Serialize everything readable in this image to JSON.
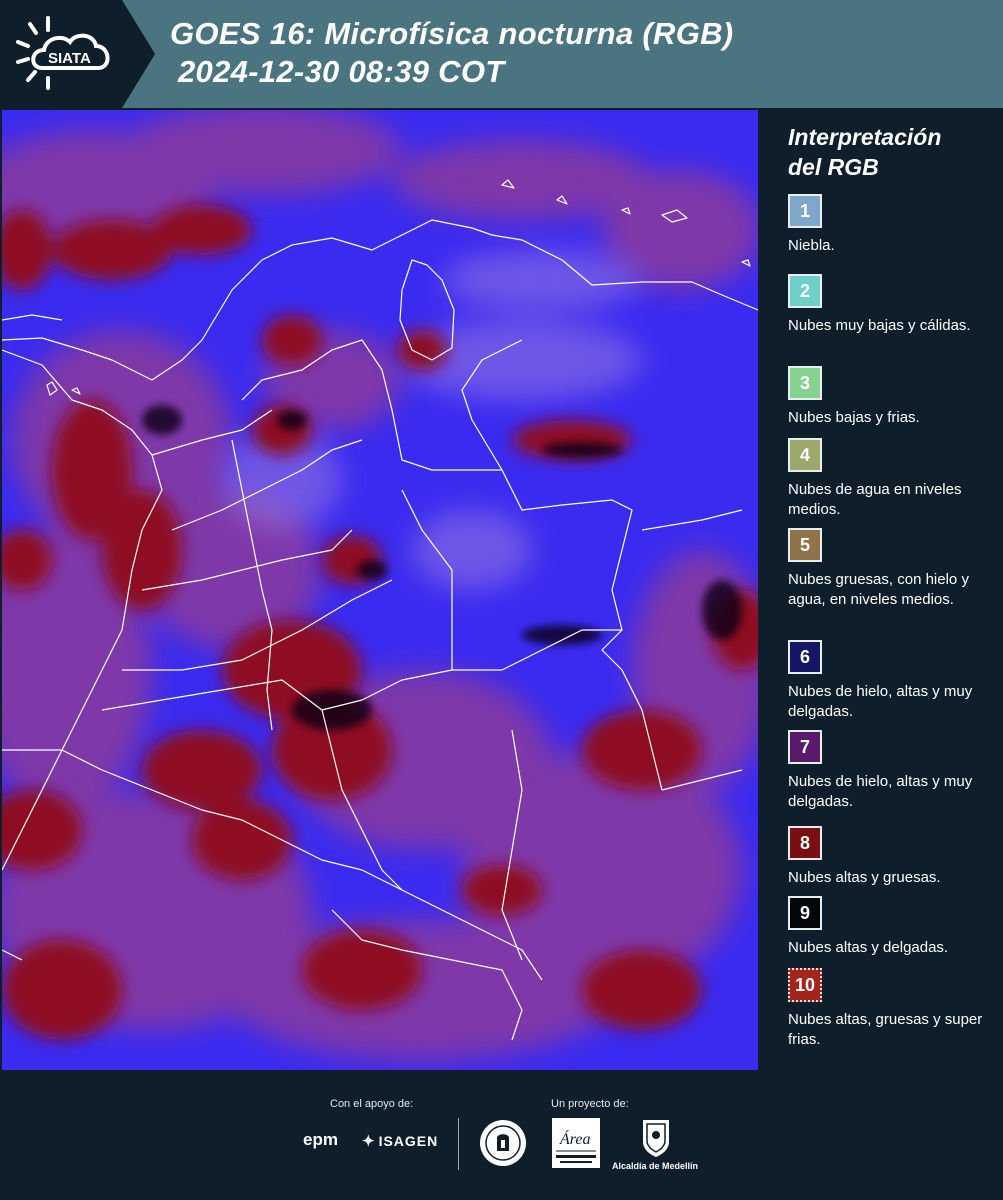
{
  "header": {
    "logo_text": "SIATA",
    "title_line1": "GOES 16: Microfísica nocturna (RGB)",
    "title_line2": "2024-12-30 08:39 COT"
  },
  "legend": {
    "title_line1": "Interpretación",
    "title_line2": "del RGB",
    "items": [
      {
        "number": "1",
        "color": "#7fa7c9",
        "description": "Niebla."
      },
      {
        "number": "2",
        "color": "#6fd0c8",
        "description": "Nubes muy bajas y cálidas."
      },
      {
        "number": "3",
        "color": "#86d28f",
        "description": "Nubes bajas y frias."
      },
      {
        "number": "4",
        "color": "#9ba86a",
        "description": "Nubes de agua en niveles medios."
      },
      {
        "number": "5",
        "color": "#8e7448",
        "description": "Nubes gruesas, con hielo y agua, en niveles medios."
      },
      {
        "number": "6",
        "color": "#141766",
        "description": "Nubes de hielo, altas y muy delgadas."
      },
      {
        "number": "7",
        "color": "#5a1a6c",
        "description": "Nubes de hielo, altas y muy delgadas."
      },
      {
        "number": "8",
        "color": "#7a0f12",
        "description": "Nubes altas y gruesas."
      },
      {
        "number": "9",
        "color": "#050608",
        "description": "Nubes altas y delgadas."
      },
      {
        "number": "10",
        "color": "#a3241a",
        "description": "Nubes altas, gruesas y super frias."
      }
    ]
  },
  "footer": {
    "support_label": "Con el apoyo de:",
    "project_label": "Un proyecto de:",
    "sponsor_1": "epm",
    "sponsor_2": "ISAGEN",
    "partner_1": "Área Metropolitana",
    "partner_2": "Alcaldía de Medellín"
  },
  "colors": {
    "header_bg": "#4a7480",
    "page_bg": "#0e1e2a",
    "map_blue": "#3a2bf0",
    "map_red": "#8e1020",
    "map_purple": "#8a3a9c"
  }
}
